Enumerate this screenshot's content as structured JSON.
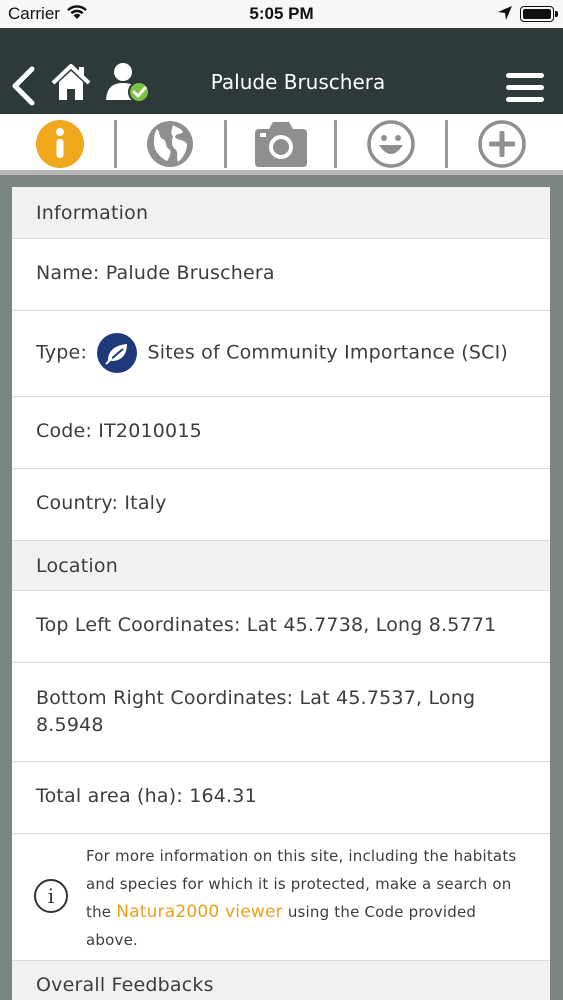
{
  "status_bar": {
    "carrier": "Carrier",
    "time": "5:05 PM"
  },
  "header": {
    "title": "Palude Bruschera",
    "icons": [
      "back-icon",
      "home-icon",
      "user-verified-icon",
      "hamburger-menu-icon"
    ]
  },
  "tabs": [
    {
      "icon": "info-icon",
      "active": true
    },
    {
      "icon": "globe-icon",
      "active": false
    },
    {
      "icon": "camera-icon",
      "active": false
    },
    {
      "icon": "smiley-icon",
      "active": false
    },
    {
      "icon": "plus-circle-icon",
      "active": false
    }
  ],
  "colors": {
    "header_bg": "#2e3939",
    "accent": "#f0a81c",
    "link": "#e8a21a",
    "type_badge": "#1f3a7a"
  },
  "information": {
    "section_title": "Information",
    "name_label": "Name:",
    "name_value": "Palude Bruschera",
    "type_label": "Type:",
    "type_value": "Sites of Community Importance (SCI)",
    "code_label": "Code:",
    "code_value": "IT2010015",
    "country_label": "Country:",
    "country_value": "Italy"
  },
  "location": {
    "section_title": "Location",
    "top_left_label": "Top Left Coordinates:",
    "top_left_value": "Lat 45.7738, Long 8.5771",
    "bottom_right_label": "Bottom Right Coordinates:",
    "bottom_right_value_line1": "Lat 45.7537, Long",
    "bottom_right_value_line2": "8.5948",
    "area_label": "Total area (ha):",
    "area_value": "164.31"
  },
  "note": {
    "text_before": "For more information on this site, including the habitats and species for which it is protected, make a search on the",
    "link": "Natura2000 viewer",
    "text_after": "using the Code provided above."
  },
  "feedback": {
    "section_title": "Overall Feedbacks"
  }
}
